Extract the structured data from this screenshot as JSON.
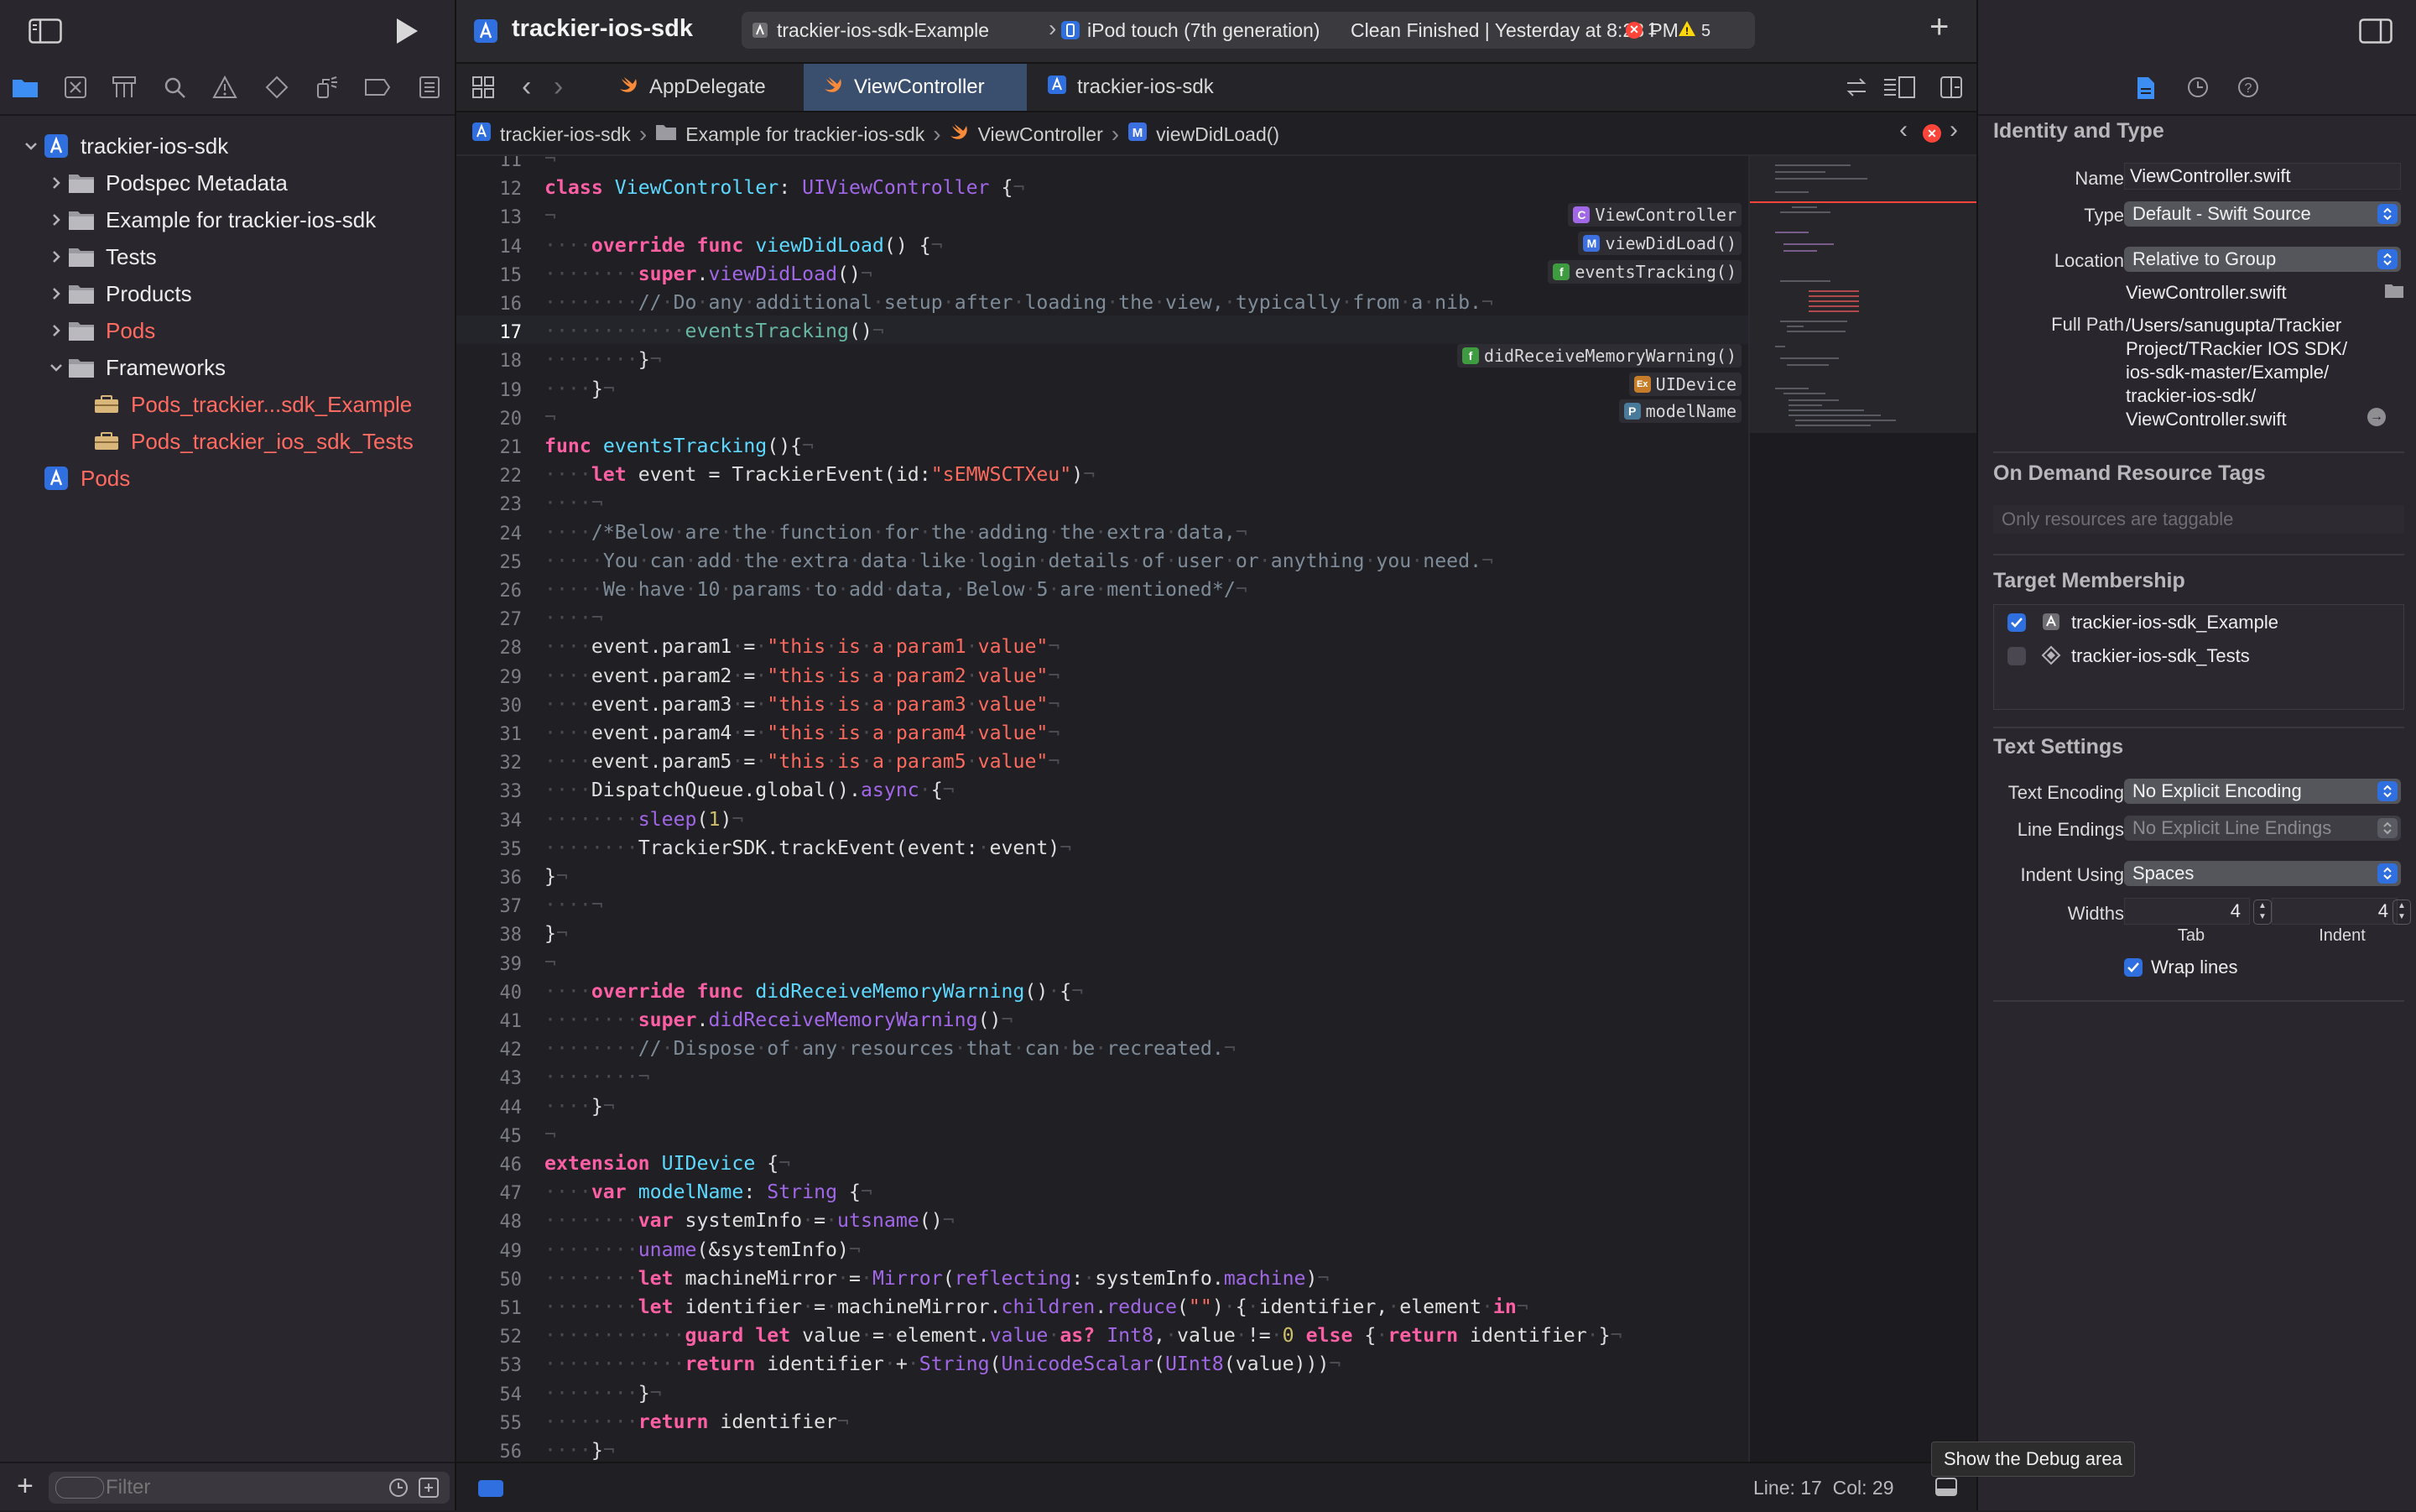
{
  "navigator": {
    "tree": [
      {
        "label": "trackier-ios-sdk",
        "indent": 0,
        "icon": "xcode-project-icon",
        "expanded": true,
        "red": false
      },
      {
        "label": "Podspec Metadata",
        "indent": 1,
        "icon": "folder-icon",
        "expanded": false,
        "red": false
      },
      {
        "label": "Example for trackier-ios-sdk",
        "indent": 1,
        "icon": "folder-icon",
        "expanded": false,
        "red": false
      },
      {
        "label": "Tests",
        "indent": 1,
        "icon": "folder-icon",
        "expanded": false,
        "red": false
      },
      {
        "label": "Products",
        "indent": 1,
        "icon": "folder-icon",
        "expanded": false,
        "red": false
      },
      {
        "label": "Pods",
        "indent": 1,
        "icon": "folder-icon",
        "expanded": false,
        "red": true
      },
      {
        "label": "Frameworks",
        "indent": 1,
        "icon": "folder-icon",
        "expanded": true,
        "red": false
      },
      {
        "label": "Pods_trackier...sdk_Example",
        "indent": 2,
        "icon": "framework-icon",
        "expanded": null,
        "red": true
      },
      {
        "label": "Pods_trackier_ios_sdk_Tests",
        "indent": 2,
        "icon": "framework-icon",
        "expanded": null,
        "red": true
      },
      {
        "label": "Pods",
        "indent": 0,
        "icon": "xcode-project-icon",
        "expanded": null,
        "red": true
      }
    ],
    "filter_placeholder": "Filter"
  },
  "toolbar": {
    "project_title": "trackier-ios-sdk",
    "scheme": "trackier-ios-sdk-Example",
    "device": "iPod touch (7th generation)",
    "status": "Clean Finished | Yesterday at 8:28 PM",
    "error_count": "1",
    "warning_count": "5"
  },
  "tabs": [
    {
      "label": "AppDelegate",
      "icon": "swift-file-icon",
      "active": false
    },
    {
      "label": "ViewController",
      "icon": "swift-file-icon",
      "active": true
    },
    {
      "label": "trackier-ios-sdk",
      "icon": "xcode-project-icon",
      "active": false
    }
  ],
  "jumpbar": {
    "crumbs": [
      "trackier-ios-sdk",
      "Example for trackier-ios-sdk",
      "ViewController",
      "viewDidLoad()"
    ]
  },
  "editor": {
    "current_line": 17,
    "lines": [
      {
        "n": 11,
        "c": "<span class=\"dot\">¬</span>"
      },
      {
        "n": 12,
        "c": "<span class=\"kw\">class</span> <span class=\"ty\">ViewController</span>: <span class=\"nm\">UIViewController</span> {<span class=\"dot\">¬</span>"
      },
      {
        "n": 13,
        "c": "<span class=\"dot\">¬</span>"
      },
      {
        "n": 14,
        "c": "<span class=\"dot\">····</span><span class=\"kw\">override</span> <span class=\"kw\">func</span> <span class=\"ty\">viewDidLoad</span>() {<span class=\"dot\">¬</span>"
      },
      {
        "n": 15,
        "c": "<span class=\"dot\">········</span><span class=\"kw\">super</span>.<span class=\"nm\">viewDidLoad</span>()<span class=\"dot\">¬</span>"
      },
      {
        "n": 16,
        "c": "<span class=\"dot\">········</span><span class=\"cm\">//<span class=\"dot\">·</span>Do<span class=\"dot\">·</span>any<span class=\"dot\">·</span>additional<span class=\"dot\">·</span>setup<span class=\"dot\">·</span>after<span class=\"dot\">·</span>loading<span class=\"dot\">·</span>the<span class=\"dot\">·</span>view,<span class=\"dot\">·</span>typically<span class=\"dot\">·</span>from<span class=\"dot\">·</span>a<span class=\"dot\">·</span>nib.</span><span class=\"dot\">¬</span>"
      },
      {
        "n": 17,
        "c": "<span class=\"dot\">············</span><span class=\"fn\">eventsTracking</span>()<span class=\"dot\">¬</span>"
      },
      {
        "n": 18,
        "c": "<span class=\"dot\">········</span>}<span class=\"dot\">¬</span>"
      },
      {
        "n": 19,
        "c": "<span class=\"dot\">····</span>}<span class=\"dot\">¬</span>"
      },
      {
        "n": 20,
        "c": "<span class=\"dot\">¬</span>"
      },
      {
        "n": 21,
        "c": "<span class=\"kw\">func</span> <span class=\"ty\">eventsTracking</span>(){<span class=\"dot\">¬</span>"
      },
      {
        "n": 22,
        "c": "<span class=\"dot\">····</span><span class=\"kw\">let</span> event = TrackierEvent(id:<span class=\"str\">\"sEMWSCTXeu\"</span>)<span class=\"dot\">¬</span>"
      },
      {
        "n": 23,
        "c": "<span class=\"dot\">····¬</span>"
      },
      {
        "n": 24,
        "c": "<span class=\"dot\">····</span><span class=\"cm\">/*Below<span class=\"dot\">·</span>are<span class=\"dot\">·</span>the<span class=\"dot\">·</span>function<span class=\"dot\">·</span>for<span class=\"dot\">·</span>the<span class=\"dot\">·</span>adding<span class=\"dot\">·</span>the<span class=\"dot\">·</span>extra<span class=\"dot\">·</span>data,</span><span class=\"dot\">¬</span>"
      },
      {
        "n": 25,
        "c": "<span class=\"dot\">·····</span><span class=\"cm\">You<span class=\"dot\">·</span>can<span class=\"dot\">·</span>add<span class=\"dot\">·</span>the<span class=\"dot\">·</span>extra<span class=\"dot\">·</span>data<span class=\"dot\">·</span>like<span class=\"dot\">·</span>login<span class=\"dot\">·</span>details<span class=\"dot\">·</span>of<span class=\"dot\">·</span>user<span class=\"dot\">·</span>or<span class=\"dot\">·</span>anything<span class=\"dot\">·</span>you<span class=\"dot\">·</span>need.</span><span class=\"dot\">¬</span>"
      },
      {
        "n": 26,
        "c": "<span class=\"dot\">·····</span><span class=\"cm\">We<span class=\"dot\">·</span>have<span class=\"dot\">·</span>10<span class=\"dot\">·</span>params<span class=\"dot\">·</span>to<span class=\"dot\">·</span>add<span class=\"dot\">·</span>data,<span class=\"dot\">·</span>Below<span class=\"dot\">·</span>5<span class=\"dot\">·</span>are<span class=\"dot\">·</span>mentioned*/</span><span class=\"dot\">¬</span>"
      },
      {
        "n": 27,
        "c": "<span class=\"dot\">····¬</span>"
      },
      {
        "n": 28,
        "c": "<span class=\"dot\">····</span>event.param1<span class=\"dot\">·</span>=<span class=\"dot\">·</span><span class=\"str\">\"this<span class=\"dot\">·</span>is<span class=\"dot\">·</span>a<span class=\"dot\">·</span>param1<span class=\"dot\">·</span>value\"</span><span class=\"dot\">¬</span>"
      },
      {
        "n": 29,
        "c": "<span class=\"dot\">····</span>event.param2<span class=\"dot\">·</span>=<span class=\"dot\">·</span><span class=\"str\">\"this<span class=\"dot\">·</span>is<span class=\"dot\">·</span>a<span class=\"dot\">·</span>param2<span class=\"dot\">·</span>value\"</span><span class=\"dot\">¬</span>"
      },
      {
        "n": 30,
        "c": "<span class=\"dot\">····</span>event.param3<span class=\"dot\">·</span>=<span class=\"dot\">·</span><span class=\"str\">\"this<span class=\"dot\">·</span>is<span class=\"dot\">·</span>a<span class=\"dot\">·</span>param3<span class=\"dot\">·</span>value\"</span><span class=\"dot\">¬</span>"
      },
      {
        "n": 31,
        "c": "<span class=\"dot\">····</span>event.param4<span class=\"dot\">·</span>=<span class=\"dot\">·</span><span class=\"str\">\"this<span class=\"dot\">·</span>is<span class=\"dot\">·</span>a<span class=\"dot\">·</span>param4<span class=\"dot\">·</span>value\"</span><span class=\"dot\">¬</span>"
      },
      {
        "n": 32,
        "c": "<span class=\"dot\">····</span>event.param5<span class=\"dot\">·</span>=<span class=\"dot\">·</span><span class=\"str\">\"this<span class=\"dot\">·</span>is<span class=\"dot\">·</span>a<span class=\"dot\">·</span>param5<span class=\"dot\">·</span>value\"</span><span class=\"dot\">¬</span>"
      },
      {
        "n": 33,
        "c": "<span class=\"dot\">····</span>DispatchQueue.global().<span class=\"nm\">async</span><span class=\"dot\">·</span>{<span class=\"dot\">¬</span>"
      },
      {
        "n": 34,
        "c": "<span class=\"dot\">········</span><span class=\"nm\">sleep</span>(<span class=\"num\">1</span>)<span class=\"dot\">¬</span>"
      },
      {
        "n": 35,
        "c": "<span class=\"dot\">········</span>TrackierSDK.trackEvent(event:<span class=\"dot\">·</span>event)<span class=\"dot\">¬</span>"
      },
      {
        "n": 36,
        "c": "}<span class=\"dot\">¬</span>"
      },
      {
        "n": 37,
        "c": "<span class=\"dot\">····¬</span>"
      },
      {
        "n": 38,
        "c": "}<span class=\"dot\">¬</span>"
      },
      {
        "n": 39,
        "c": "<span class=\"dot\">¬</span>"
      },
      {
        "n": 40,
        "c": "<span class=\"dot\">····</span><span class=\"kw\">override</span> <span class=\"kw\">func</span> <span class=\"ty\">didReceiveMemoryWarning</span>()<span class=\"dot\">·</span>{<span class=\"dot\">¬</span>"
      },
      {
        "n": 41,
        "c": "<span class=\"dot\">········</span><span class=\"kw\">super</span>.<span class=\"nm\">didReceiveMemoryWarning</span>()<span class=\"dot\">¬</span>"
      },
      {
        "n": 42,
        "c": "<span class=\"dot\">········</span><span class=\"cm\">//<span class=\"dot\">·</span>Dispose<span class=\"dot\">·</span>of<span class=\"dot\">·</span>any<span class=\"dot\">·</span>resources<span class=\"dot\">·</span>that<span class=\"dot\">·</span>can<span class=\"dot\">·</span>be<span class=\"dot\">·</span>recreated.</span><span class=\"dot\">¬</span>"
      },
      {
        "n": 43,
        "c": "<span class=\"dot\">········¬</span>"
      },
      {
        "n": 44,
        "c": "<span class=\"dot\">····</span>}<span class=\"dot\">¬</span>"
      },
      {
        "n": 45,
        "c": "<span class=\"dot\">¬</span>"
      },
      {
        "n": 46,
        "c": "<span class=\"kw\">extension</span> <span class=\"ty\">UIDevice</span> {<span class=\"dot\">¬</span>"
      },
      {
        "n": 47,
        "c": "<span class=\"dot\">····</span><span class=\"kw\">var</span> <span class=\"ty\">modelName</span>: <span class=\"nm\">String</span> {<span class=\"dot\">¬</span>"
      },
      {
        "n": 48,
        "c": "<span class=\"dot\">········</span><span class=\"kw\">var</span> systemInfo<span class=\"dot\">·</span>=<span class=\"dot\">·</span><span class=\"nm\">utsname</span>()<span class=\"dot\">¬</span>"
      },
      {
        "n": 49,
        "c": "<span class=\"dot\">········</span><span class=\"nm\">uname</span>(&amp;systemInfo)<span class=\"dot\">¬</span>"
      },
      {
        "n": 50,
        "c": "<span class=\"dot\">········</span><span class=\"kw\">let</span> machineMirror<span class=\"dot\">·</span>=<span class=\"dot\">·</span><span class=\"nm\">Mirror</span>(<span class=\"nm\">reflecting</span>:<span class=\"dot\">·</span>systemInfo.<span class=\"nm\">machine</span>)<span class=\"dot\">¬</span>"
      },
      {
        "n": 51,
        "c": "<span class=\"dot\">········</span><span class=\"kw\">let</span> identifier<span class=\"dot\">·</span>=<span class=\"dot\">·</span>machineMirror.<span class=\"nm\">children</span>.<span class=\"nm\">reduce</span>(<span class=\"str\">\"\"</span>)<span class=\"dot\">·</span>{<span class=\"dot\">·</span>identifier,<span class=\"dot\">·</span>element<span class=\"dot\">·</span><span class=\"kw\">in</span><span class=\"dot\">¬</span>"
      },
      {
        "n": 52,
        "c": "<span class=\"dot\">············</span><span class=\"kw\">guard</span> <span class=\"kw\">let</span> value<span class=\"dot\">·</span>=<span class=\"dot\">·</span>element.<span class=\"nm\">value</span><span class=\"dot\">·</span><span class=\"kw\">as?</span> <span class=\"nm\">Int8</span>,<span class=\"dot\">·</span>value<span class=\"dot\">·</span>!=<span class=\"dot\">·</span><span class=\"num\">0</span> <span class=\"kw\">else</span> {<span class=\"dot\">·</span><span class=\"kw\">return</span> identifier<span class=\"dot\">·</span>}<span class=\"dot\">¬</span>"
      },
      {
        "n": 53,
        "c": "<span class=\"dot\">············</span><span class=\"kw\">return</span> identifier<span class=\"dot\">·</span>+<span class=\"dot\">·</span><span class=\"nm\">String</span>(<span class=\"nm\">UnicodeScalar</span>(<span class=\"nm\">UInt8</span>(value)))<span class=\"dot\">¬</span>"
      },
      {
        "n": 54,
        "c": "<span class=\"dot\">········</span>}<span class=\"dot\">¬</span>"
      },
      {
        "n": 55,
        "c": "<span class=\"dot\">········</span><span class=\"kw\">return</span> identifier<span class=\"dot\">¬</span>"
      },
      {
        "n": 56,
        "c": "<span class=\"dot\">····</span>}<span class=\"dot\">¬</span>"
      }
    ],
    "symbol_labels": [
      {
        "badge": "C",
        "color": "#a167e6",
        "label": "ViewController"
      },
      {
        "badge": "M",
        "color": "#3c6fe0",
        "label": "viewDidLoad()"
      },
      {
        "badge": "f",
        "color": "#3f9b3f",
        "label": "eventsTracking()"
      },
      {
        "badge": "f",
        "color": "#3f9b3f",
        "label": "didReceiveMemoryWarning()"
      },
      {
        "badge": "Ex",
        "color": "#c77c2a",
        "label": "UIDevice"
      },
      {
        "badge": "P",
        "color": "#4a7a9a",
        "label": "modelName"
      }
    ]
  },
  "statusbar": {
    "position": "Line: 17  Col: 29",
    "tooltip": "Show the Debug area"
  },
  "inspector": {
    "identity_heading": "Identity and Type",
    "name_label": "Name",
    "name_value": "ViewController.swift",
    "type_label": "Type",
    "type_value": "Default - Swift Source",
    "location_label": "Location",
    "location_value": "Relative to Group",
    "location_file": "ViewController.swift",
    "fullpath_label": "Full Path",
    "fullpath_lines": [
      "/Users/sanugupta/Trackier",
      "Project/TRackier IOS SDK/",
      "ios-sdk-master/Example/",
      "trackier-ios-sdk/",
      "ViewController.swift"
    ],
    "odr_heading": "On Demand Resource Tags",
    "odr_placeholder": "Only resources are taggable",
    "target_heading": "Target Membership",
    "targets": [
      {
        "label": "trackier-ios-sdk_Example",
        "checked": true
      },
      {
        "label": "trackier-ios-sdk_Tests",
        "checked": false
      }
    ],
    "text_heading": "Text Settings",
    "encoding_label": "Text Encoding",
    "encoding_value": "No Explicit Encoding",
    "endings_label": "Line Endings",
    "endings_value": "No Explicit Line Endings",
    "indent_label": "Indent Using",
    "indent_value": "Spaces",
    "widths_label": "Widths",
    "tab_width": "4",
    "indent_width": "4",
    "tab_caption": "Tab",
    "indent_caption": "Indent",
    "wrap_label": "Wrap lines",
    "wrap_checked": true
  },
  "colors": {
    "accent": "#2f6fe0",
    "error": "#ff453a",
    "warning": "#ffd60a"
  }
}
